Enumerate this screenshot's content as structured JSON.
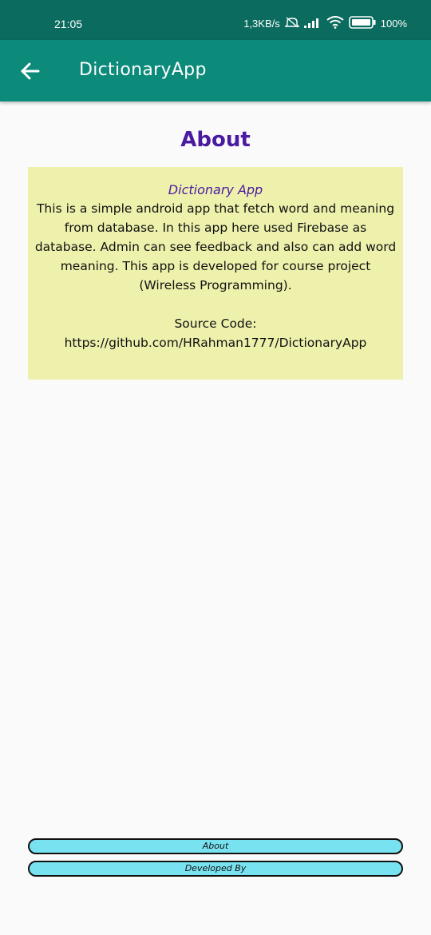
{
  "status_bar": {
    "time": "21:05",
    "net_speed": "1,3KB/s",
    "battery": "100%",
    "icons": [
      "mute-icon",
      "signal-icon",
      "wifi-icon",
      "battery-icon"
    ]
  },
  "app_bar": {
    "back_icon": "arrow-left-icon",
    "title": "DictionaryApp"
  },
  "page": {
    "heading": "About"
  },
  "card": {
    "title": "Dictionary App",
    "description": "This is a simple android app that fetch word and meaning from database. In this app here used Firebase as database. Admin can see feedback and also can add word meaning. This app is developed for course project (Wireless Programming).",
    "source_label": "Source Code:",
    "source_url": "https://github.com/HRahman1777/DictionaryApp"
  },
  "buttons": {
    "about_label": "About",
    "developed_by_label": "Developed By"
  },
  "colors": {
    "status_bar": "#0a6b5e",
    "app_bar": "#0c8a7a",
    "heading": "#4a1aa0",
    "card_background": "#eef1ac",
    "button_background": "#79e2f0"
  }
}
